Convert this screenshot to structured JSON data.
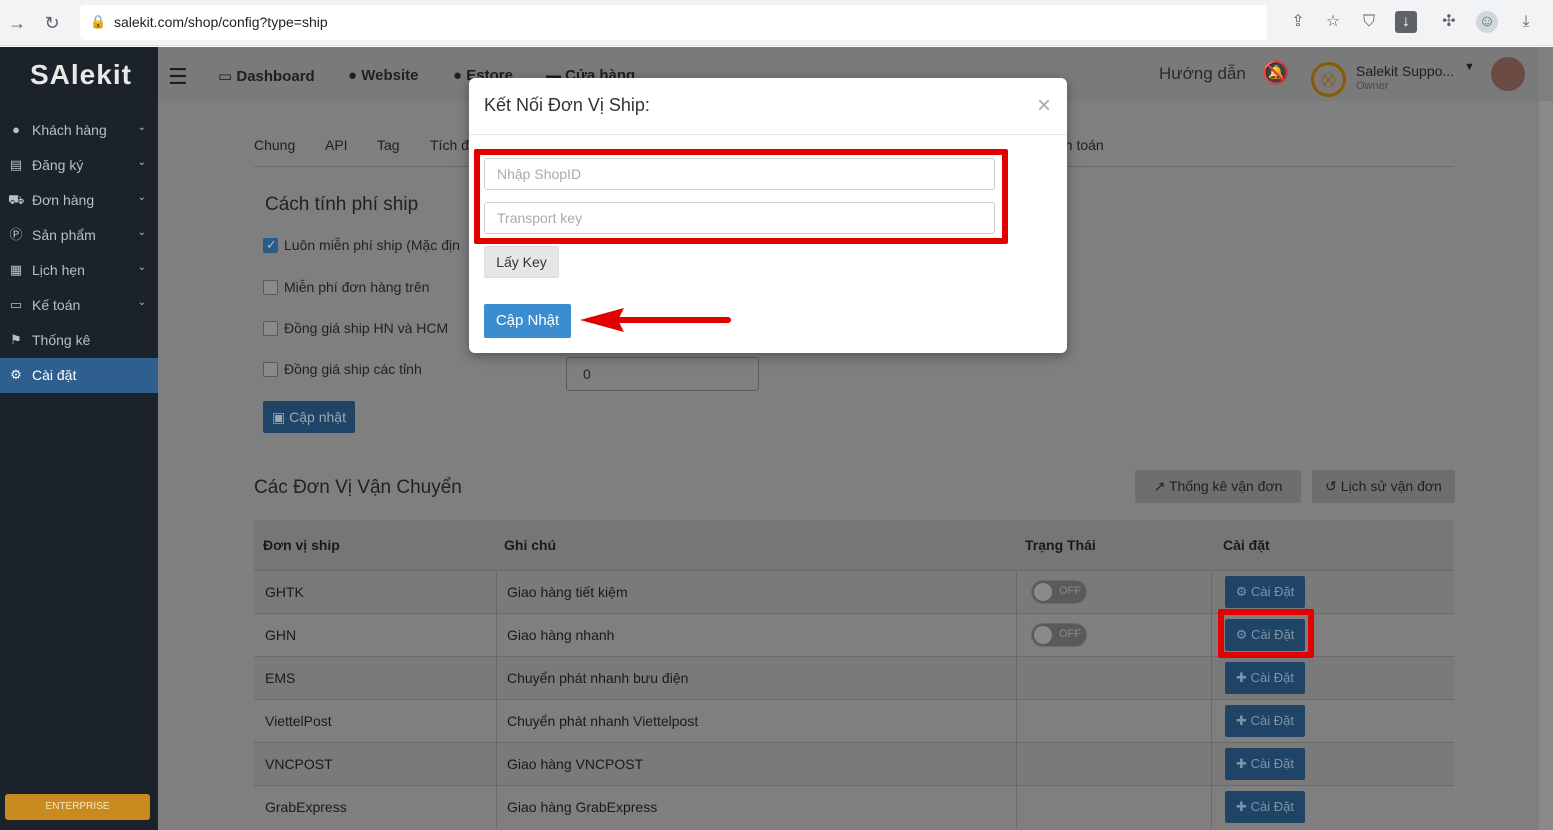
{
  "browser": {
    "url": "salekit.com/shop/config?type=ship"
  },
  "sidebar": {
    "brand": "SAlekit",
    "items": [
      {
        "label": "Khách hàng",
        "icon": "user-icon"
      },
      {
        "label": "Đăng ký",
        "icon": "list-icon"
      },
      {
        "label": "Đơn hàng",
        "icon": "cart-icon"
      },
      {
        "label": "Sản phẩm",
        "icon": "product-icon"
      },
      {
        "label": "Lịch hẹn",
        "icon": "calendar-icon"
      },
      {
        "label": "Kế toán",
        "icon": "card-icon"
      },
      {
        "label": "Thống kê",
        "icon": "flag-icon"
      },
      {
        "label": "Cài đặt",
        "icon": "gear-icon"
      }
    ],
    "enterprise_label": "ENTERPRISE"
  },
  "topbar": {
    "items": [
      "Dashboard",
      "Website",
      "Estore",
      "Cửa hàng"
    ],
    "guide": "Hướng dẫn",
    "user_name": "Salekit Suppo...",
    "user_role": "Owner"
  },
  "subtabs": [
    "Chung",
    "API",
    "Tag",
    "Tích đ",
    "nh toán"
  ],
  "ship_fee": {
    "title": "Cách tính phí ship",
    "options": [
      {
        "label": "Luôn miễn phí ship (Mặc địn",
        "checked": true
      },
      {
        "label": "Miễn phí đơn hàng trên",
        "checked": false
      },
      {
        "label": "Đồng giá ship HN và HCM",
        "checked": false
      },
      {
        "label": "Đồng giá ship các tỉnh",
        "checked": false
      }
    ],
    "province_value": "0",
    "update_button": "Cập nhật"
  },
  "carriers": {
    "title": "Các Đơn Vị Vận Chuyển",
    "stats_button": "Thống kê vận đơn",
    "history_button": "Lịch sử vận đơn",
    "headers": [
      "Đơn vị ship",
      "Ghi chú",
      "Trạng Thái",
      "Cài đặt"
    ],
    "rows": [
      {
        "name": "GHTK",
        "note": "Giao hàng tiết kiệm",
        "status": "OFF",
        "action": "Cài Đặt",
        "type": "gear"
      },
      {
        "name": "GHN",
        "note": "Giao hàng nhanh",
        "status": "OFF",
        "action": "Cài Đặt",
        "type": "gear"
      },
      {
        "name": "EMS",
        "note": "Chuyển phát nhanh bưu điện",
        "status": "",
        "action": "Cài Đặt",
        "type": "plus"
      },
      {
        "name": "ViettelPost",
        "note": "Chuyển phát nhanh Viettelpost",
        "status": "",
        "action": "Cài Đặt",
        "type": "plus"
      },
      {
        "name": "VNCPOST",
        "note": "Giao hàng VNCPOST",
        "status": "",
        "action": "Cài Đặt",
        "type": "plus"
      },
      {
        "name": "GrabExpress",
        "note": "Giao hàng GrabExpress",
        "status": "",
        "action": "Cài Đặt",
        "type": "plus"
      }
    ]
  },
  "modal": {
    "title": "Kết Nối Đơn Vị Ship:",
    "close": "×",
    "shopid_placeholder": "Nhập ShopID",
    "key_placeholder": "Transport key",
    "get_key": "Lấy Key",
    "submit": "Cập Nhật"
  },
  "colors": {
    "highlight": "#e30000",
    "primary": "#3c8dd0",
    "sidebar_bg": "#1b2229"
  }
}
